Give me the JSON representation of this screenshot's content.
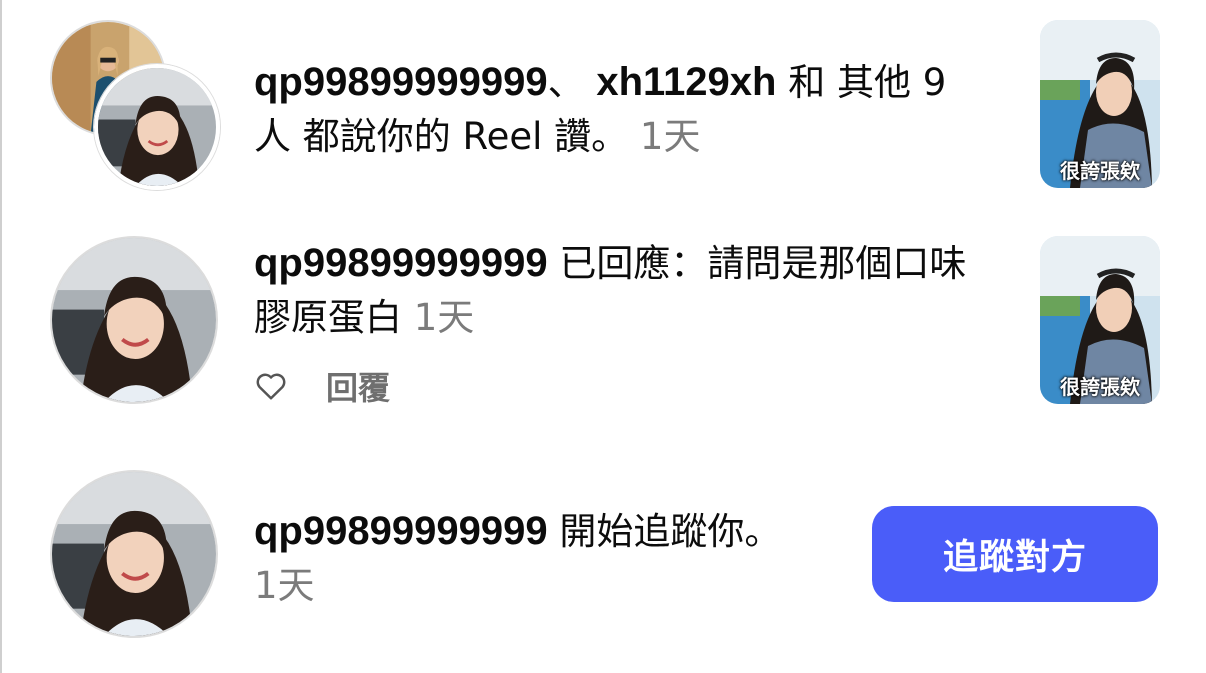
{
  "notifications": [
    {
      "users": [
        "qp99899999999",
        "xh1129xh"
      ],
      "separator": "、 ",
      "conj": " 和 其他 9 人 都說你的 Reel 讚。",
      "time": "1天",
      "thumb_caption": "很誇張欸"
    },
    {
      "user": "qp99899999999",
      "message": " 已回應：請問是那個口味膠原蛋白",
      "time": "1天",
      "like_icon": "heart-outline-icon",
      "reply_label": "回覆",
      "thumb_caption": "很誇張欸"
    },
    {
      "user": "qp99899999999",
      "message": " 開始追蹤你。",
      "time": "1天",
      "follow_label": "追蹤對方"
    }
  ],
  "colors": {
    "follow_button": "#4a5df9",
    "timestamp": "#7b7b7b",
    "text": "#0c0c0c"
  }
}
